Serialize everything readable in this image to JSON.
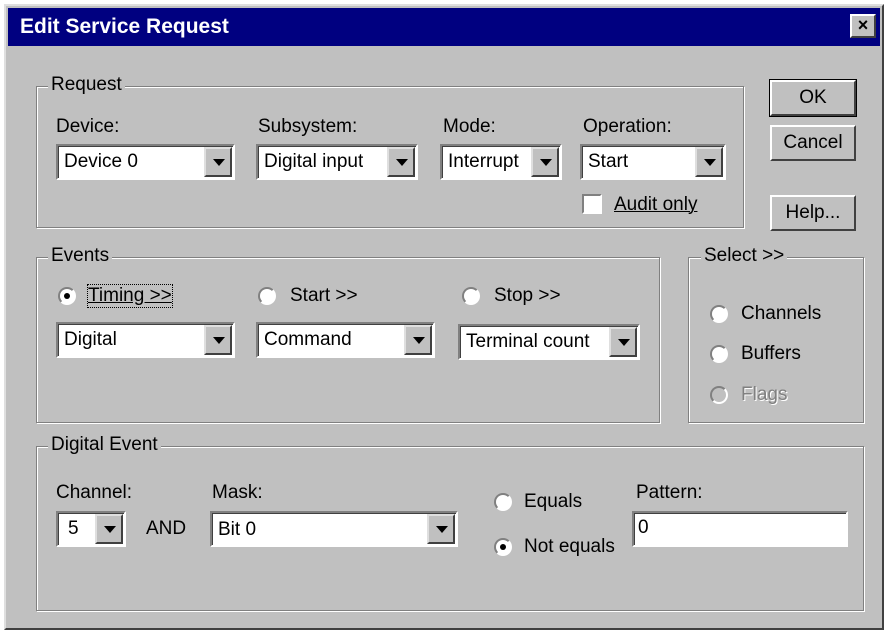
{
  "window": {
    "title": "Edit Service Request",
    "close_symbol": "×"
  },
  "buttons": {
    "ok": "OK",
    "cancel": "Cancel",
    "help": "Help..."
  },
  "request": {
    "legend": "Request",
    "device_label": "Device:",
    "device_value": "Device 0",
    "subsystem_label": "Subsystem:",
    "subsystem_value": "Digital input",
    "mode_label": "Mode:",
    "mode_value": "Interrupt",
    "operation_label": "Operation:",
    "operation_value": "Start",
    "audit_label": "Audit only",
    "audit_checked": false
  },
  "events": {
    "legend": "Events",
    "timing_label": "Timing >>",
    "timing_value": "Digital",
    "timing_selected": true,
    "start_label": "Start >>",
    "start_value": "Command",
    "start_selected": false,
    "stop_label": "Stop >>",
    "stop_value": "Terminal count",
    "stop_selected": false
  },
  "select": {
    "legend": "Select >>",
    "channels": "Channels",
    "buffers": "Buffers",
    "flags": "Flags",
    "flags_disabled": true
  },
  "digital_event": {
    "legend": "Digital Event",
    "channel_label": "Channel:",
    "channel_value": "5",
    "and_label": "AND",
    "mask_label": "Mask:",
    "mask_value": "Bit 0",
    "equals_label": "Equals",
    "not_equals_label": "Not equals",
    "not_equals_selected": true,
    "pattern_label": "Pattern:",
    "pattern_value": "0"
  }
}
